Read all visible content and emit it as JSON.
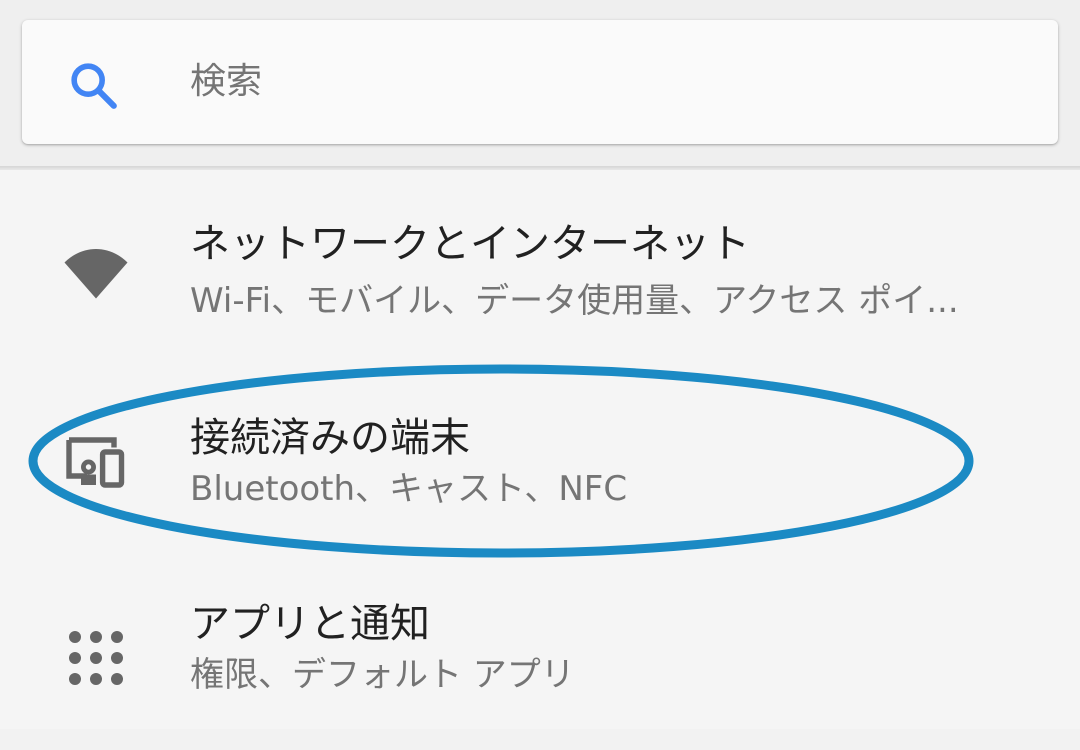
{
  "search": {
    "placeholder": "検索",
    "icon": "search-icon"
  },
  "items": [
    {
      "title": "ネットワークとインターネット",
      "subtitle": "Wi-Fi、モバイル、データ使用量、アクセス ポイ...",
      "icon": "wifi-icon"
    },
    {
      "title": "接続済みの端末",
      "subtitle": "Bluetooth、キャスト、NFC",
      "icon": "devices-icon",
      "highlighted": true
    },
    {
      "title": "アプリと通知",
      "subtitle": "権限、デフォルト アプリ",
      "icon": "apps-grid-icon"
    }
  ],
  "colors": {
    "accent": "#4285f4",
    "highlight": "#1b8ac4",
    "title": "#212121",
    "subtitle": "#757575",
    "icon": "#666666"
  }
}
